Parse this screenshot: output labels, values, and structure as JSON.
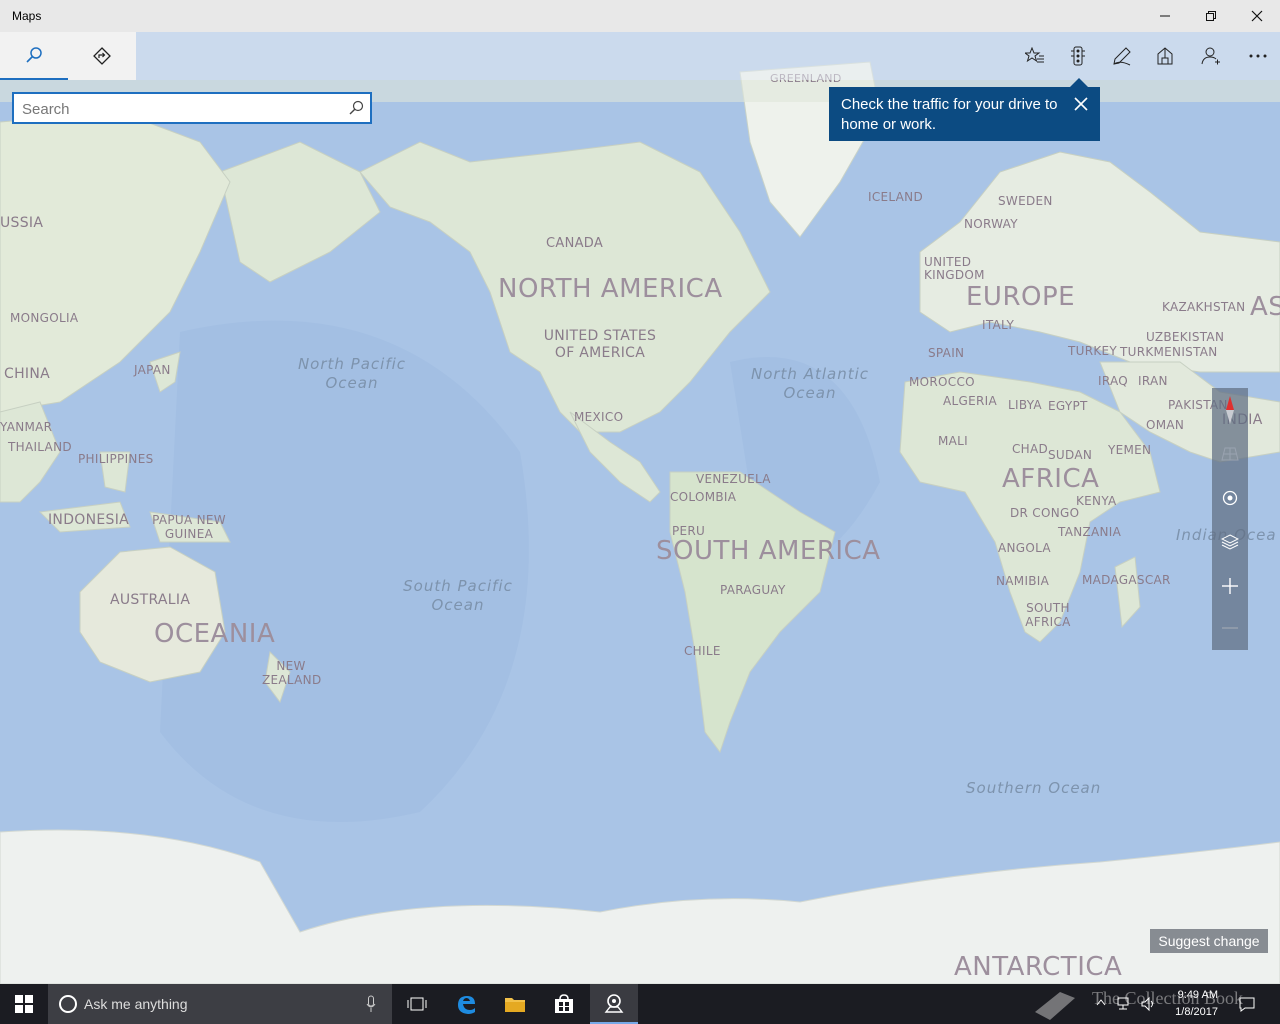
{
  "window": {
    "title": "Maps"
  },
  "toolbar": {
    "tabs": [
      "search",
      "directions"
    ],
    "icons": [
      "favorites-icon",
      "traffic-icon",
      "ink-icon",
      "3d-cities-icon",
      "account-icon",
      "more-icon"
    ]
  },
  "search": {
    "placeholder": "Search",
    "value": ""
  },
  "tip": {
    "text": "Check the traffic for your drive to home or work."
  },
  "map": {
    "labels": [
      {
        "text": "GREENLAND",
        "kind": "country"
      },
      {
        "text": "ICELAND",
        "kind": "country"
      },
      {
        "text": "SWEDEN",
        "kind": "country"
      },
      {
        "text": "NORWAY",
        "kind": "country"
      },
      {
        "text": "UNITED KINGDOM",
        "kind": "country"
      },
      {
        "text": "EUROPE",
        "kind": "continent"
      },
      {
        "text": "KAZAKHSTAN",
        "kind": "country"
      },
      {
        "text": "ITALY",
        "kind": "country"
      },
      {
        "text": "UZBEKISTAN",
        "kind": "country"
      },
      {
        "text": "TURKEY",
        "kind": "country"
      },
      {
        "text": "TURKMENISTAN",
        "kind": "country"
      },
      {
        "text": "SPAIN",
        "kind": "country"
      },
      {
        "text": "IRAQ",
        "kind": "country"
      },
      {
        "text": "IRAN",
        "kind": "country"
      },
      {
        "text": "MOROCCO",
        "kind": "country"
      },
      {
        "text": "ALGERIA",
        "kind": "country"
      },
      {
        "text": "LIBYA",
        "kind": "country"
      },
      {
        "text": "EGYPT",
        "kind": "country"
      },
      {
        "text": "PAKISTAN",
        "kind": "country"
      },
      {
        "text": "INDIA",
        "kind": "country"
      },
      {
        "text": "OMAN",
        "kind": "country"
      },
      {
        "text": "MALI",
        "kind": "country"
      },
      {
        "text": "CHAD",
        "kind": "country"
      },
      {
        "text": "SUDAN",
        "kind": "country"
      },
      {
        "text": "YEMEN",
        "kind": "country"
      },
      {
        "text": "AFRICA",
        "kind": "continent"
      },
      {
        "text": "KENYA",
        "kind": "country"
      },
      {
        "text": "DR CONGO",
        "kind": "country"
      },
      {
        "text": "TANZANIA",
        "kind": "country"
      },
      {
        "text": "ANGOLA",
        "kind": "country"
      },
      {
        "text": "NAMIBIA",
        "kind": "country"
      },
      {
        "text": "MADAGASCAR",
        "kind": "country"
      },
      {
        "text": "SOUTH AFRICA",
        "kind": "country"
      },
      {
        "text": "CANADA",
        "kind": "country"
      },
      {
        "text": "NORTH AMERICA",
        "kind": "continent"
      },
      {
        "text": "UNITED STATES OF AMERICA",
        "kind": "country"
      },
      {
        "text": "MEXICO",
        "kind": "country"
      },
      {
        "text": "VENEZUELA",
        "kind": "country"
      },
      {
        "text": "COLOMBIA",
        "kind": "country"
      },
      {
        "text": "PERU",
        "kind": "country"
      },
      {
        "text": "SOUTH AMERICA",
        "kind": "continent"
      },
      {
        "text": "PARAGUAY",
        "kind": "country"
      },
      {
        "text": "CHILE",
        "kind": "country"
      },
      {
        "text": "USSIA",
        "kind": "country"
      },
      {
        "text": "MONGOLIA",
        "kind": "country"
      },
      {
        "text": "CHINA",
        "kind": "country"
      },
      {
        "text": "JAPAN",
        "kind": "country"
      },
      {
        "text": "YANMAR",
        "kind": "country"
      },
      {
        "text": "THAILAND",
        "kind": "country"
      },
      {
        "text": "PHILIPPINES",
        "kind": "country"
      },
      {
        "text": "INDONESIA",
        "kind": "country"
      },
      {
        "text": "PAPUA NEW GUINEA",
        "kind": "country"
      },
      {
        "text": "AUSTRALIA",
        "kind": "country"
      },
      {
        "text": "OCEANIA",
        "kind": "continent"
      },
      {
        "text": "NEW ZEALAND",
        "kind": "country"
      },
      {
        "text": "ANTARCTICA",
        "kind": "continent"
      },
      {
        "text": "AS",
        "kind": "continent"
      }
    ],
    "oceans": [
      {
        "text": "North Pacific Ocean"
      },
      {
        "text": "North Atlantic Ocean"
      },
      {
        "text": "South Pacific Ocean"
      },
      {
        "text": "Indian Ocea"
      },
      {
        "text": "Southern Ocean"
      }
    ]
  },
  "map_controls": [
    "compass-icon",
    "tilt-icon",
    "locate-icon",
    "layers-icon",
    "zoom-in-icon",
    "zoom-out-icon"
  ],
  "suggest_change": "Suggest change",
  "taskbar": {
    "search_placeholder": "Ask me anything",
    "time": "9:49 AM",
    "date": "1/8/2017",
    "watermark": "The Collection Book"
  }
}
